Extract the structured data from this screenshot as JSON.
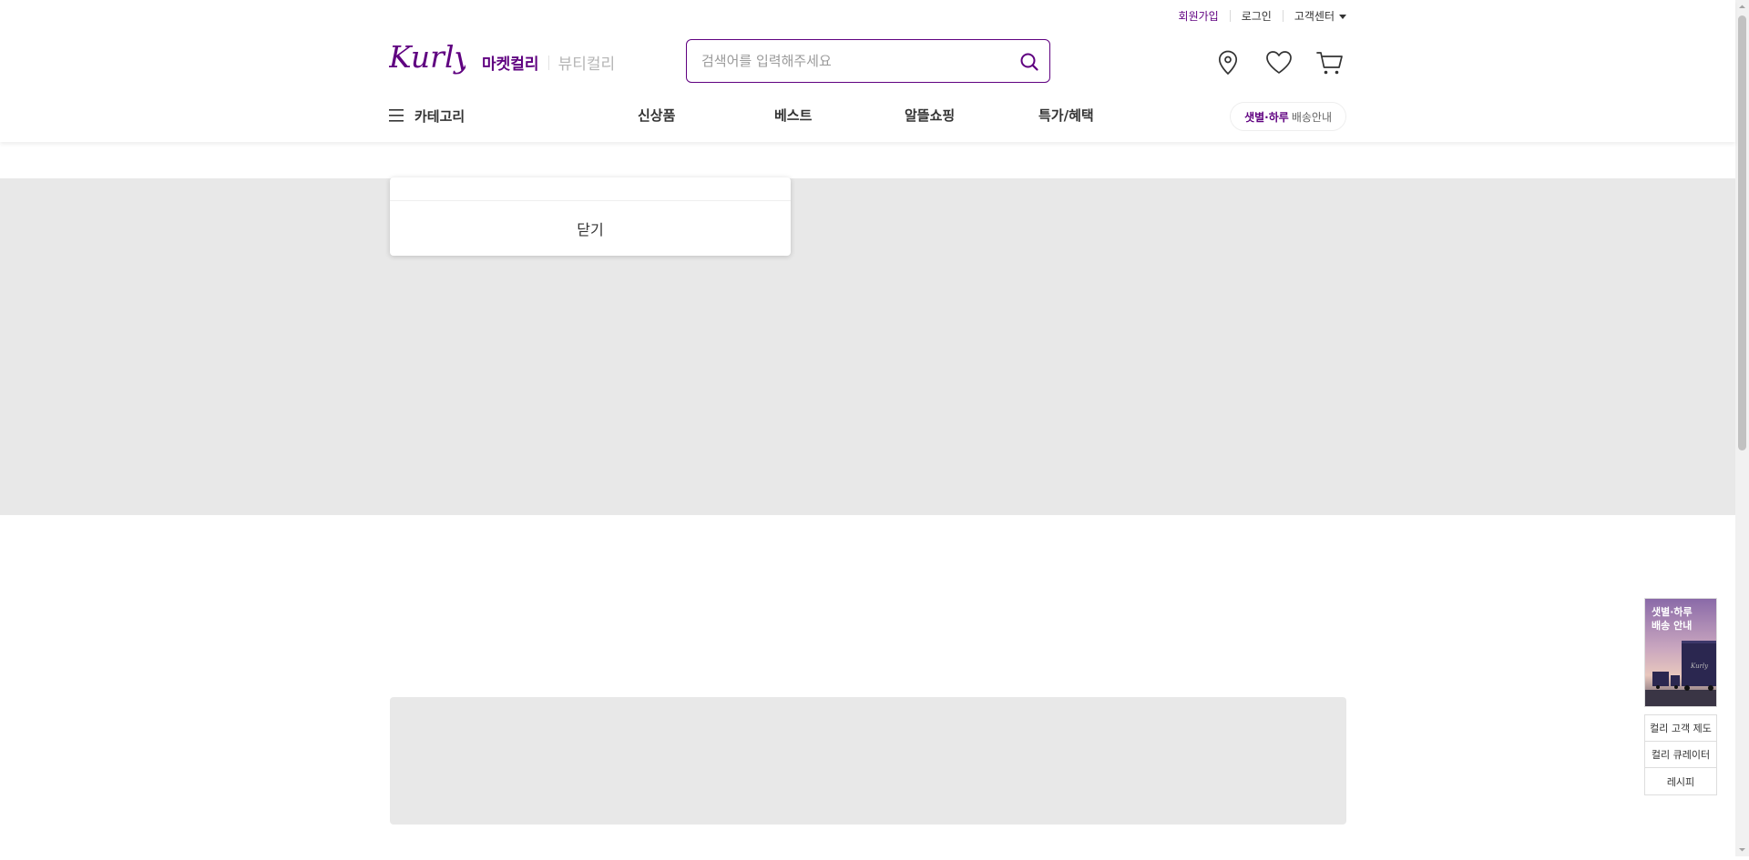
{
  "top_links": {
    "signup": "회원가입",
    "login": "로그인",
    "customer_center": "고객센터"
  },
  "logo": {
    "alt": "Kurly",
    "text": "Kurly",
    "color": "#5f0080"
  },
  "mall_tabs": {
    "market": "마켓컬리",
    "beauty": "뷰티컬리"
  },
  "search": {
    "placeholder": "검색어를 입력해주세요",
    "value": ""
  },
  "user_icons": [
    "location-icon",
    "heart-icon",
    "cart-icon"
  ],
  "gnb": {
    "category": "카테고리",
    "items": [
      "신상품",
      "베스트",
      "알뜰쇼핑",
      "특가/혜택"
    ],
    "delivery_pill": {
      "highlight": "샛별·하루",
      "rest": "배송안내"
    }
  },
  "popup": {
    "close_label": "닫기"
  },
  "side_widget": {
    "promo_line1": "샛별·하루",
    "promo_line2": "배송 안내",
    "links": [
      "컬리 고객 제도",
      "컬리 큐레이터",
      "레시피"
    ]
  },
  "colors": {
    "brand": "#5f0080",
    "placeholder_block": "#e8e8e8"
  }
}
